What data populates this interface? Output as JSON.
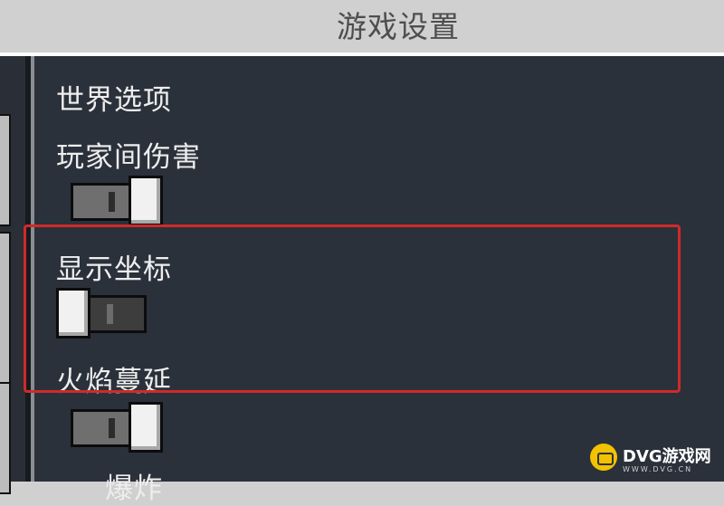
{
  "window": {
    "title": "游戏设置"
  },
  "settings": {
    "section_label": "世界选项",
    "items": [
      {
        "label": "玩家间伤害",
        "enabled": true
      },
      {
        "label": "显示坐标",
        "enabled": false
      },
      {
        "label": "火焰蔓延",
        "enabled": true
      }
    ],
    "partial_label": "爆炸"
  },
  "highlight": {
    "color": "#cf2a2a"
  },
  "watermark": {
    "brand": "DVG游戏网",
    "domain": "WWW.DVG.CN",
    "logo": "gamepad-icon"
  },
  "colors": {
    "panel_background": "#2b313b",
    "title_bar": "#d0d0d0",
    "toggle_knob": "#f1f1f1"
  }
}
